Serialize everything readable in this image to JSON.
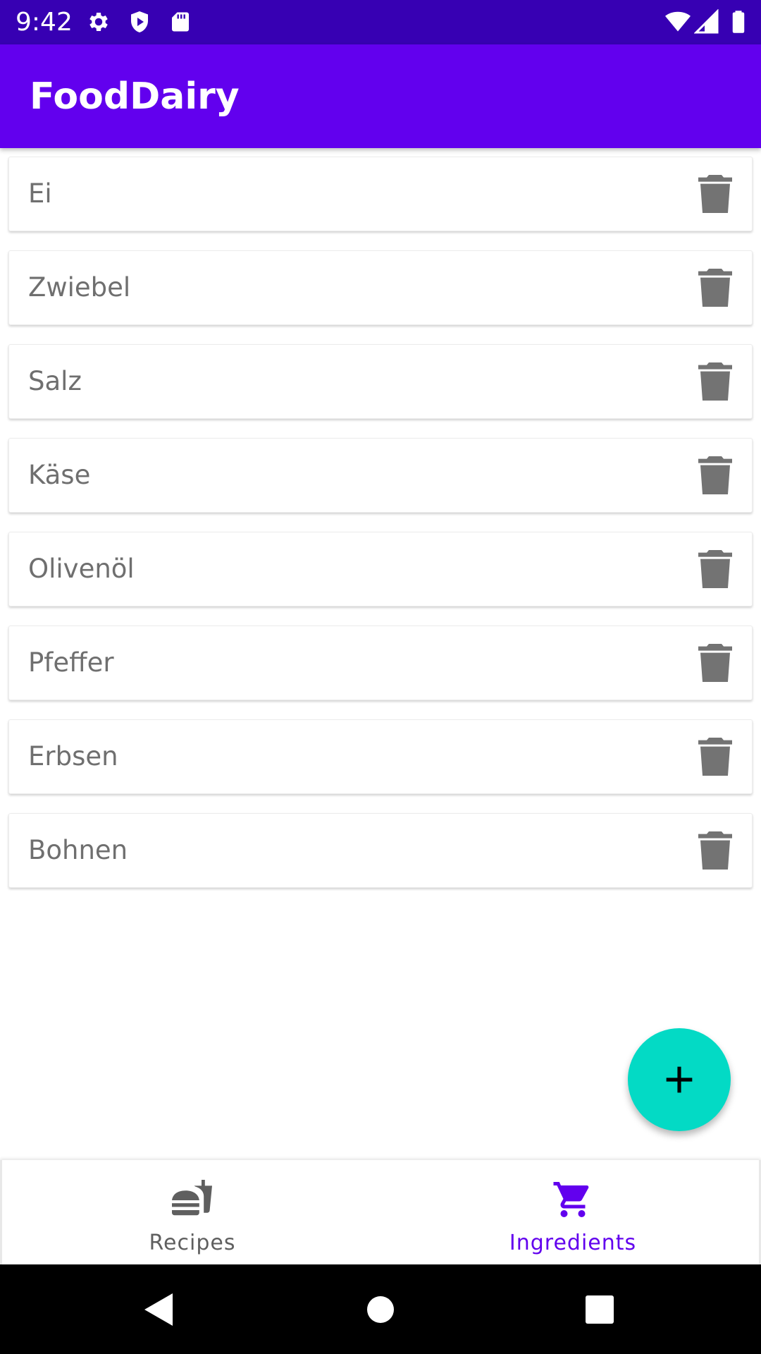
{
  "status_bar": {
    "time": "9:42",
    "icons_left": [
      "gear-icon",
      "shield-icon",
      "sd-card-icon"
    ],
    "icons_right": [
      "wifi-icon",
      "signal-icon",
      "battery-icon"
    ]
  },
  "app_bar": {
    "title": "FoodDairy"
  },
  "ingredients": [
    {
      "name": "Ei"
    },
    {
      "name": "Zwiebel"
    },
    {
      "name": "Salz"
    },
    {
      "name": "Käse"
    },
    {
      "name": "Olivenöl"
    },
    {
      "name": "Pfeffer"
    },
    {
      "name": "Erbsen"
    },
    {
      "name": "Bohnen"
    }
  ],
  "fab": {
    "icon": "plus-icon"
  },
  "bottom_nav": {
    "items": [
      {
        "label": "Recipes",
        "icon": "fastfood-icon",
        "selected": false
      },
      {
        "label": "Ingredients",
        "icon": "shopping-cart-icon",
        "selected": true
      }
    ]
  },
  "system_nav": {
    "buttons": [
      "back-icon",
      "home-icon",
      "recents-icon"
    ]
  },
  "colors": {
    "status_bar": "#3700b3",
    "primary": "#6200ee",
    "accent": "#03dac5",
    "item_text": "#6f6f6f",
    "icon_gray": "#737373"
  }
}
